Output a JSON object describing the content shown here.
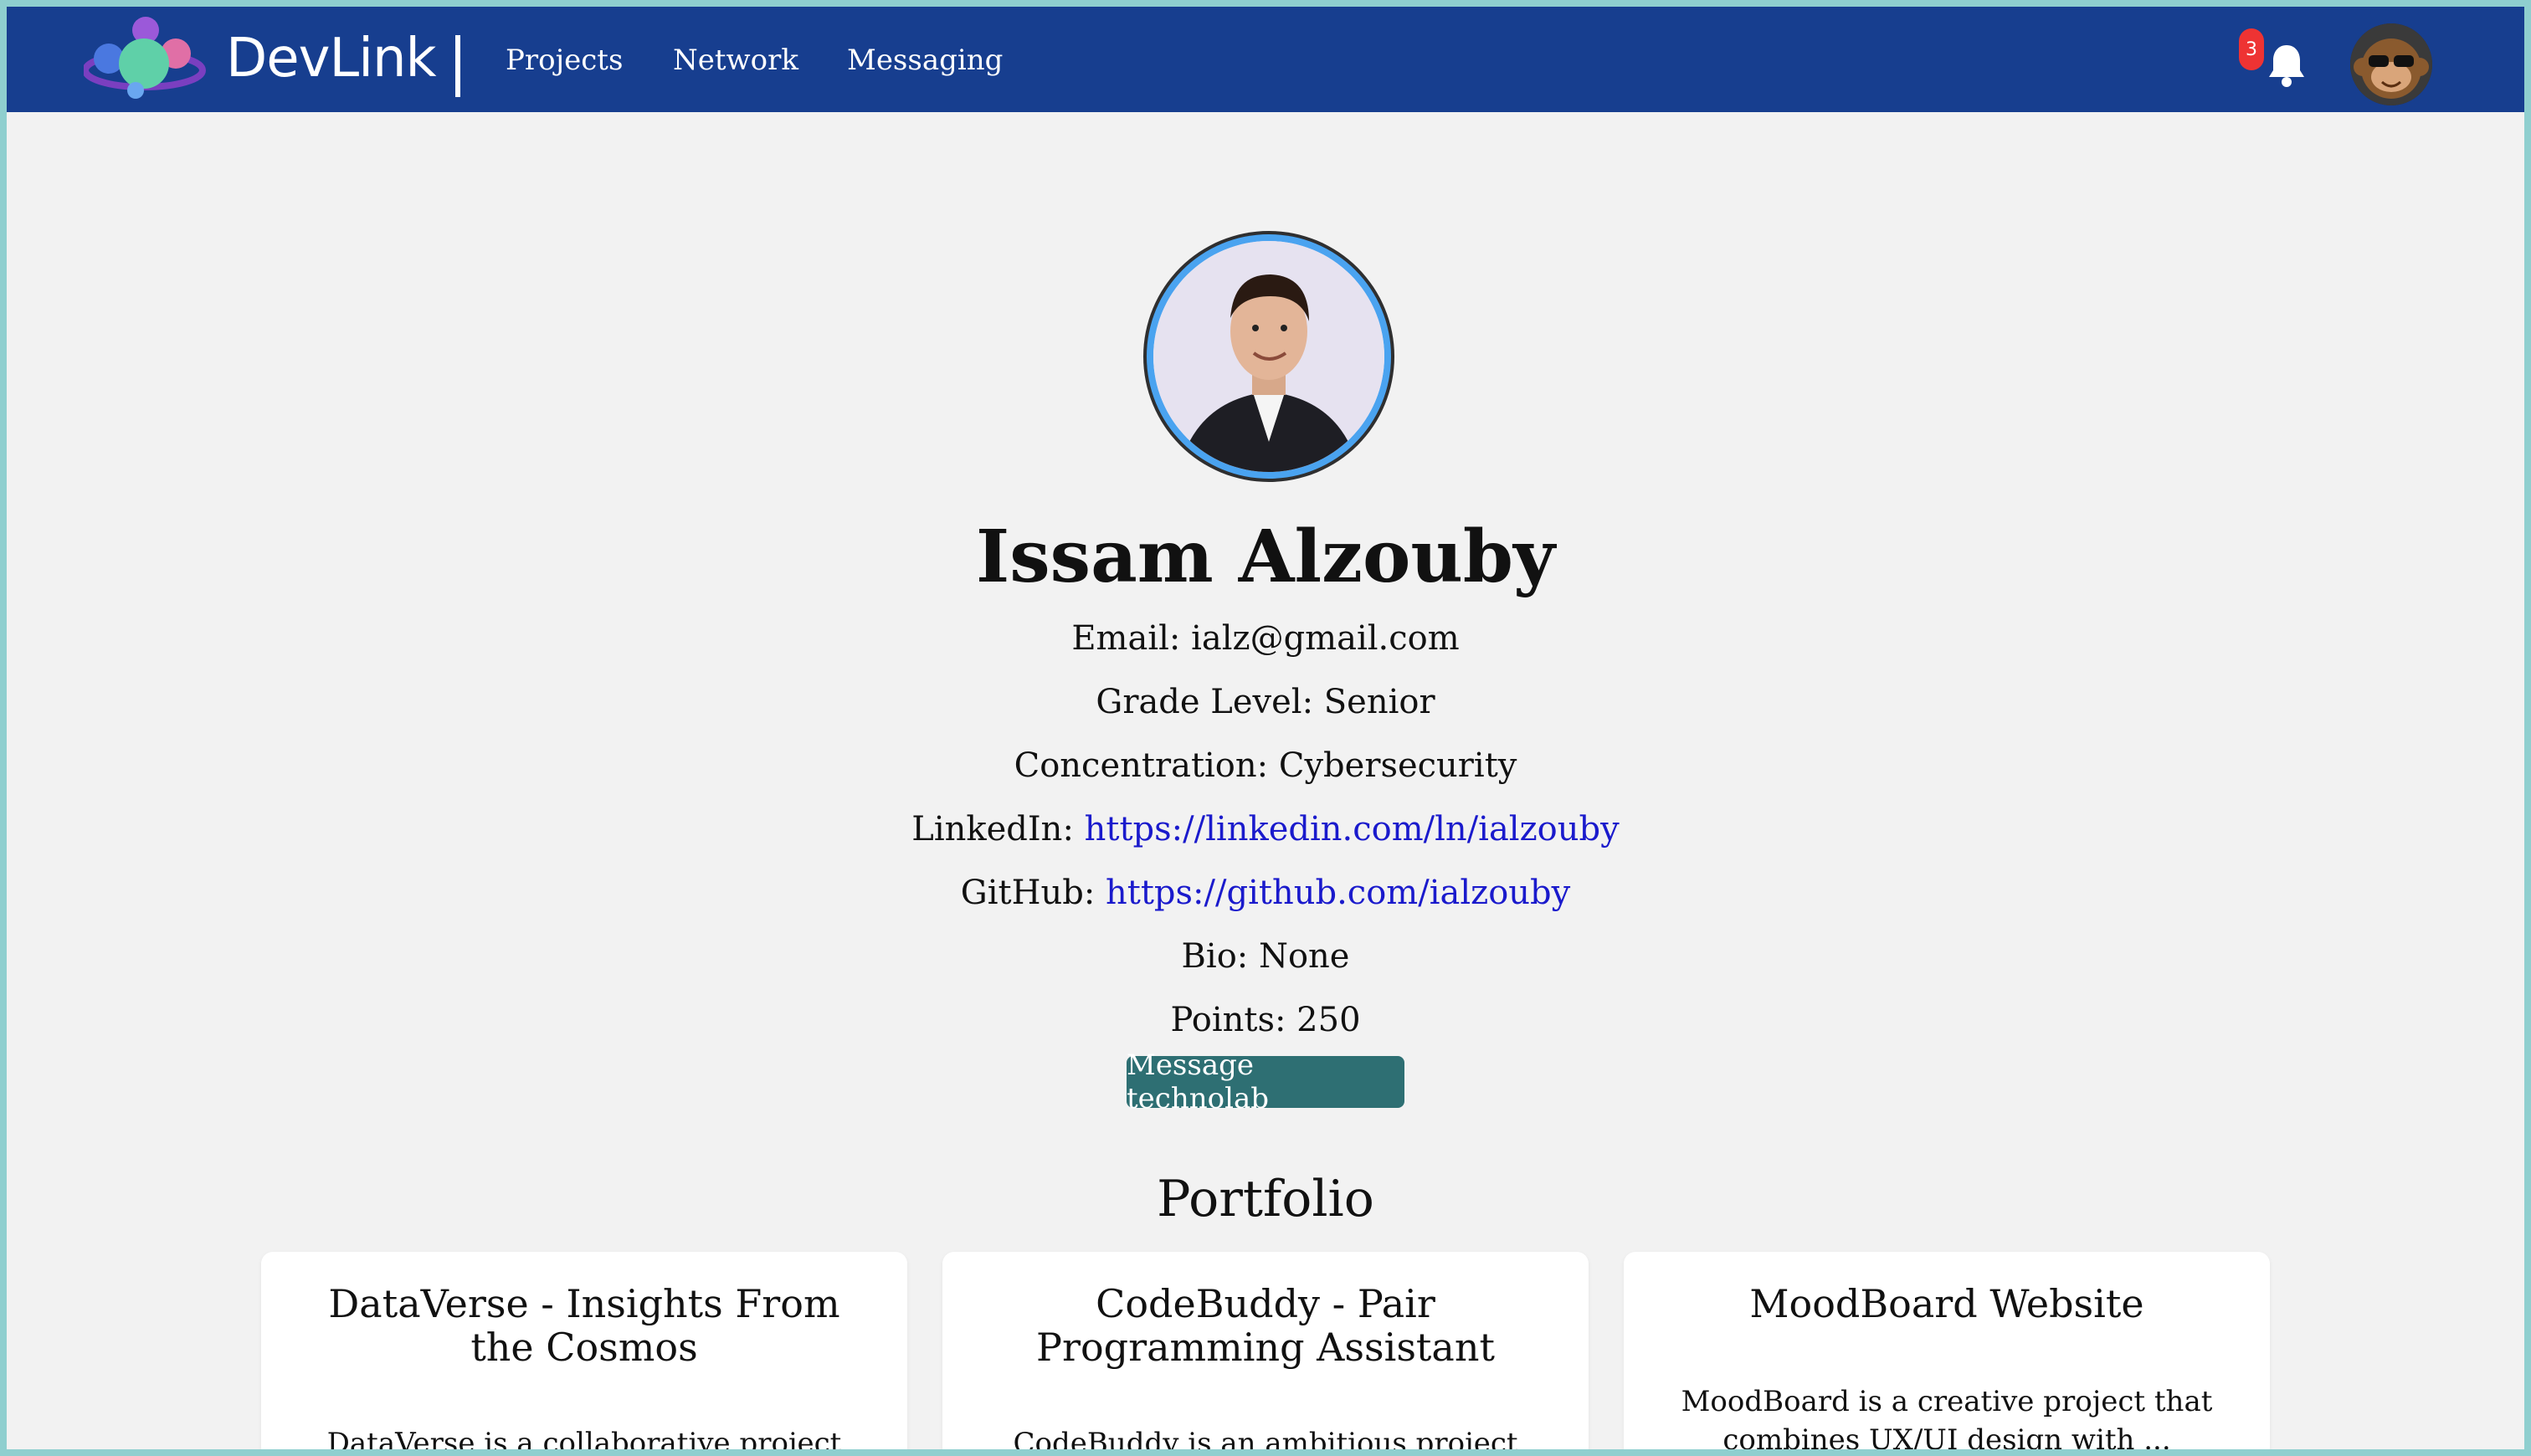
{
  "navbar": {
    "brand": "DevLink",
    "links": [
      "Projects",
      "Network",
      "Messaging"
    ],
    "notification_count": "3",
    "accent_color": "#173e8f"
  },
  "profile": {
    "name": "Issam Alzouby",
    "email": "Email: ialz@gmail.com",
    "grade": "Grade Level: Senior",
    "concentration": "Concentration: Cybersecurity",
    "linkedin_label": "LinkedIn:",
    "linkedin_url": "https://linkedin.com/ln/ialzouby",
    "github_label": "GitHub:",
    "github_url": "https://github.com/ialzouby",
    "bio": "Bio: None",
    "points": "Points: 250",
    "message_button": "Message technolab"
  },
  "portfolio": {
    "title": "Portfolio",
    "cards": [
      {
        "title": "DataVerse - Insights From the Cosmos",
        "desc": "DataVerse is a collaborative project focused"
      },
      {
        "title": "CodeBuddy - Pair Programming Assistant",
        "desc": "CodeBuddy is an ambitious project aimed at"
      },
      {
        "title": "MoodBoard Website",
        "desc": "MoodBoard is a creative project that combines UX/UI design with ..."
      }
    ]
  }
}
